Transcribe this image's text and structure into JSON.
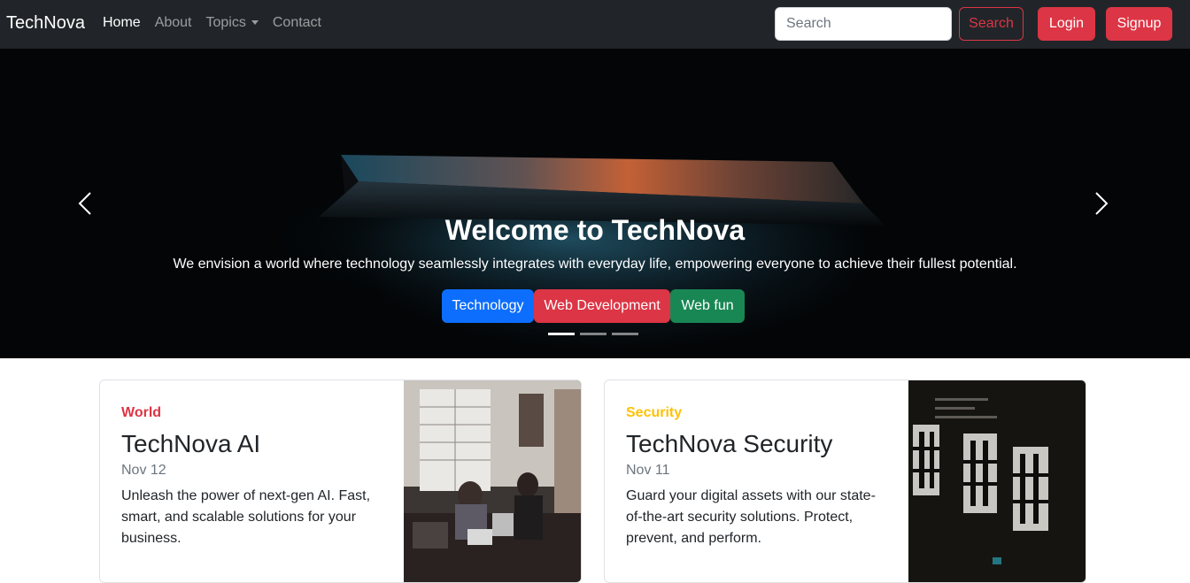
{
  "navbar": {
    "brand": "TechNova",
    "links": [
      {
        "label": "Home",
        "active": true
      },
      {
        "label": "About",
        "active": false
      },
      {
        "label": "Topics",
        "active": false,
        "dropdown": true
      },
      {
        "label": "Contact",
        "active": false
      }
    ],
    "search_placeholder": "Search",
    "search_button": "Search",
    "login_button": "Login",
    "signup_button": "Signup"
  },
  "hero": {
    "title": "Welcome to TechNova",
    "subtitle": "We envision a world where technology seamlessly integrates with everyday life, empowering everyone to achieve their fullest potential.",
    "buttons": [
      {
        "label": "Technology",
        "color": "#0d6efd"
      },
      {
        "label": "Web Development",
        "color": "#dc3545"
      },
      {
        "label": "Web fun",
        "color": "#198754"
      }
    ],
    "slides_total": 3,
    "active_slide": 1
  },
  "cards": [
    {
      "category": "World",
      "category_color": "#dc3545",
      "title": "TechNova AI",
      "date": "Nov 12",
      "text": "Unleash the power of next-gen AI. Fast, smart, and scalable solutions for your business."
    },
    {
      "category": "Security",
      "category_color": "#ffc107",
      "title": "TechNova Security",
      "date": "Nov 11",
      "text": "Guard your digital assets with our state-of-the-art security solutions. Protect, prevent, and perform."
    }
  ],
  "colors": {
    "navbar_bg": "#212529",
    "danger": "#dc3545",
    "primary": "#0d6efd",
    "success": "#198754",
    "warning": "#ffc107"
  }
}
